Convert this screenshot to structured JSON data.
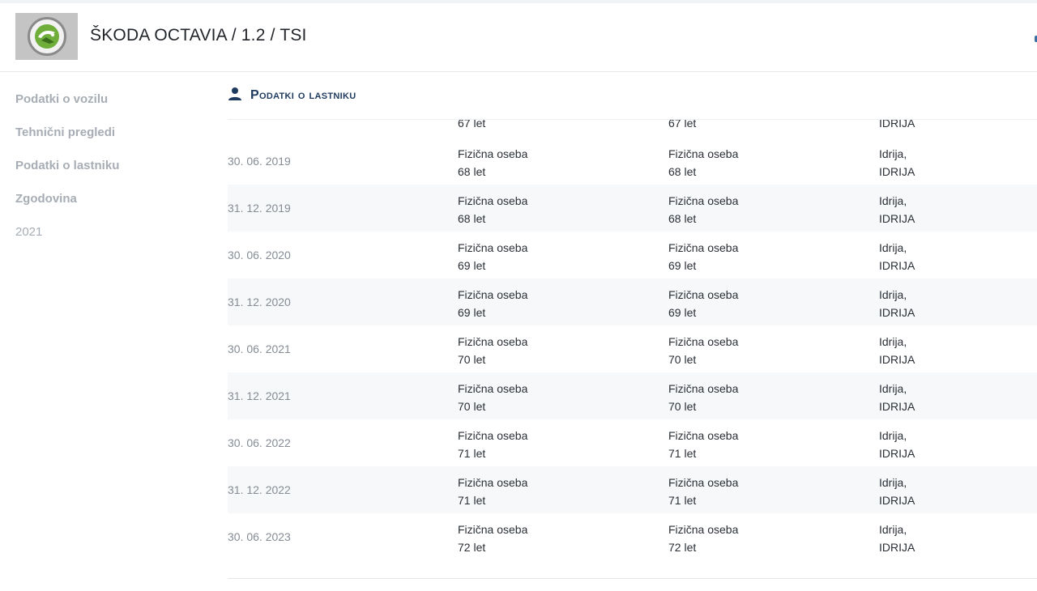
{
  "header": {
    "title": "ŠKODA OCTAVIA / 1.2 / TSI",
    "logo_icon": "skoda-logo"
  },
  "sidebar": {
    "items": [
      {
        "label": "Podatki o vozilu"
      },
      {
        "label": "Tehnični pregledi"
      },
      {
        "label": "Podatki o lastniku"
      },
      {
        "label": "Zgodovina"
      },
      {
        "label": "2021"
      }
    ]
  },
  "section": {
    "title": "Podatki o lastniku",
    "icon": "person-icon",
    "accent_color": "#1f3a5f"
  },
  "partial_row": {
    "a_age": "67 let",
    "b_age": "67 let",
    "c_city": "IDRIJA"
  },
  "rows": [
    {
      "date": "30. 06. 2019",
      "a_type": "Fizična oseba",
      "a_age": "68 let",
      "b_type": "Fizična oseba",
      "b_age": "68 let",
      "c_place": "Idrija,",
      "c_city": "IDRIJA"
    },
    {
      "date": "31. 12. 2019",
      "a_type": "Fizična oseba",
      "a_age": "68 let",
      "b_type": "Fizična oseba",
      "b_age": "68 let",
      "c_place": "Idrija,",
      "c_city": "IDRIJA"
    },
    {
      "date": "30. 06. 2020",
      "a_type": "Fizična oseba",
      "a_age": "69 let",
      "b_type": "Fizična oseba",
      "b_age": "69 let",
      "c_place": "Idrija,",
      "c_city": "IDRIJA"
    },
    {
      "date": "31. 12. 2020",
      "a_type": "Fizična oseba",
      "a_age": "69 let",
      "b_type": "Fizična oseba",
      "b_age": "69 let",
      "c_place": "Idrija,",
      "c_city": "IDRIJA"
    },
    {
      "date": "30. 06. 2021",
      "a_type": "Fizična oseba",
      "a_age": "70 let",
      "b_type": "Fizična oseba",
      "b_age": "70 let",
      "c_place": "Idrija,",
      "c_city": "IDRIJA"
    },
    {
      "date": "31. 12. 2021",
      "a_type": "Fizična oseba",
      "a_age": "70 let",
      "b_type": "Fizična oseba",
      "b_age": "70 let",
      "c_place": "Idrija,",
      "c_city": "IDRIJA"
    },
    {
      "date": "30. 06. 2022",
      "a_type": "Fizična oseba",
      "a_age": "71 let",
      "b_type": "Fizična oseba",
      "b_age": "71 let",
      "c_place": "Idrija,",
      "c_city": "IDRIJA"
    },
    {
      "date": "31. 12. 2022",
      "a_type": "Fizična oseba",
      "a_age": "71 let",
      "b_type": "Fizična oseba",
      "b_age": "71 let",
      "c_place": "Idrija,",
      "c_city": "IDRIJA"
    },
    {
      "date": "30. 06. 2023",
      "a_type": "Fizična oseba",
      "a_age": "72 let",
      "b_type": "Fizična oseba",
      "b_age": "72 let",
      "c_place": "Idrija,",
      "c_city": "IDRIJA"
    }
  ]
}
